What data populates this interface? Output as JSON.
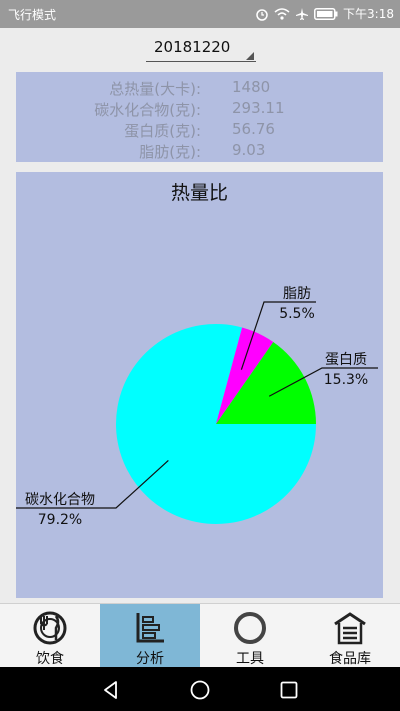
{
  "status_bar": {
    "left_text": "飞行模式",
    "time": "下午3:18",
    "icons": [
      "alarm-icon",
      "wifi-icon",
      "airplane-icon",
      "battery-icon"
    ]
  },
  "date_selector": {
    "value": "20181220"
  },
  "summary": {
    "rows": [
      {
        "label": "总热量(大卡):",
        "value": "1480"
      },
      {
        "label": "碳水化合物(克):",
        "value": "293.11"
      },
      {
        "label": "蛋白质(克):",
        "value": "56.76"
      },
      {
        "label": "脂肪(克):",
        "value": "9.03"
      }
    ]
  },
  "chart_data": {
    "type": "pie",
    "title": "热量比",
    "slices": [
      {
        "label": "碳水化合物",
        "value": 79.2,
        "display": "79.2%",
        "color": "#00ffff"
      },
      {
        "label": "脂肪",
        "value": 5.5,
        "display": "5.5%",
        "color": "#ff00ff"
      },
      {
        "label": "蛋白质",
        "value": 15.3,
        "display": "15.3%",
        "color": "#00ff00"
      }
    ]
  },
  "bottom_nav": {
    "active": 1,
    "tabs": [
      {
        "label": "饮食",
        "icon": "food-icon"
      },
      {
        "label": "分析",
        "icon": "analysis-icon"
      },
      {
        "label": "工具",
        "icon": "tools-icon"
      },
      {
        "label": "食品库",
        "icon": "food-library-icon"
      }
    ]
  },
  "system_nav": {
    "icons": [
      "back-icon",
      "home-icon",
      "recents-icon"
    ]
  }
}
